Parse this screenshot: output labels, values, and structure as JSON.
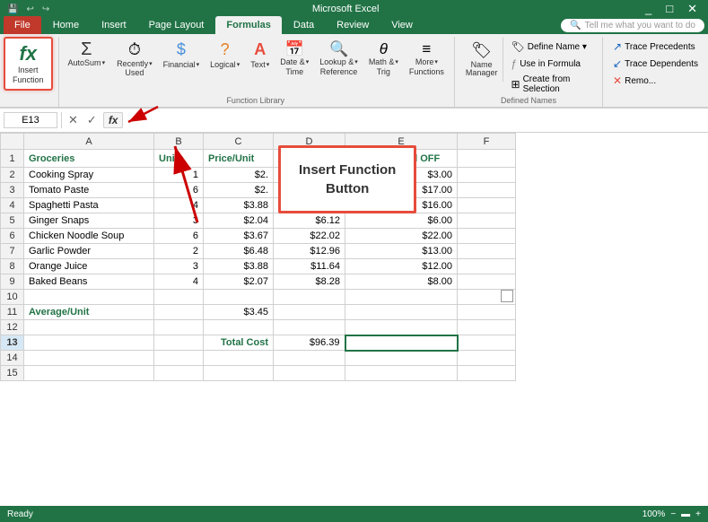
{
  "tabs": {
    "items": [
      "File",
      "Home",
      "Insert",
      "Page Layout",
      "Formulas",
      "Data",
      "Review",
      "View"
    ],
    "active": "Formulas"
  },
  "ribbon": {
    "group1": {
      "label": "",
      "buttons": [
        {
          "id": "insert-function",
          "icon": "fx",
          "label": "Insert\nFunction",
          "active": true
        }
      ]
    },
    "group2": {
      "label": "Function Library",
      "buttons": [
        {
          "id": "autosum",
          "icon": "Σ",
          "label": "AutoSum"
        },
        {
          "id": "recently-used",
          "icon": "⏱",
          "label": "Recently\nUsed"
        },
        {
          "id": "financial",
          "icon": "$",
          "label": "Financial"
        },
        {
          "id": "logical",
          "icon": "?",
          "label": "Logical"
        },
        {
          "id": "text",
          "icon": "A",
          "label": "Text"
        },
        {
          "id": "date-time",
          "icon": "📅",
          "label": "Date &\nTime"
        },
        {
          "id": "lookup-ref",
          "icon": "🔍",
          "label": "Lookup &\nReference"
        },
        {
          "id": "math-trig",
          "icon": "θ",
          "label": "Math &\nTrig"
        },
        {
          "id": "more-functions",
          "icon": "≡",
          "label": "More\nFunctions"
        }
      ]
    },
    "group3": {
      "label": "Defined Names",
      "buttons": [
        {
          "id": "name-manager",
          "label": "Name\nManager"
        }
      ],
      "right_items": [
        "Define Name ▾",
        "Use in Formula",
        "Create from Selection"
      ]
    },
    "group4": {
      "label": "",
      "buttons": [
        "Trace Precedents",
        "Trace Dependents",
        "Remo..."
      ]
    }
  },
  "formulaBar": {
    "cellRef": "E13",
    "fxLabel": "fx"
  },
  "spreadsheet": {
    "columns": [
      "",
      "A",
      "B",
      "C",
      "D",
      "E",
      "F"
    ],
    "activeCell": "E13",
    "rows": [
      {
        "num": 1,
        "A": "Groceries",
        "B": "Units",
        "C": "Price/Unit",
        "D": "",
        "E": "Cost Rounded OFF",
        "F": "",
        "aStyle": "green",
        "eStyle": "green"
      },
      {
        "num": 2,
        "A": "Cooking Spray",
        "B": "1",
        "C": "$2.",
        "D": "",
        "E": "$3.00",
        "F": "",
        "cStyle": "right",
        "eStyle": "right"
      },
      {
        "num": 3,
        "A": "Tomato Paste",
        "B": "6",
        "C": "$2.",
        "D": "",
        "E": "$17.00",
        "F": "",
        "cStyle": "right",
        "eStyle": "right"
      },
      {
        "num": 4,
        "A": "Spaghetti Pasta",
        "B": "4",
        "C": "$3.88",
        "D": "$15.52",
        "E": "$16.00",
        "F": "",
        "cStyle": "right",
        "dStyle": "right",
        "eStyle": "right"
      },
      {
        "num": 5,
        "A": "Ginger Snaps",
        "B": "3",
        "C": "$2.04",
        "D": "$6.12",
        "E": "$6.00",
        "F": "",
        "cStyle": "right",
        "dStyle": "right",
        "eStyle": "right"
      },
      {
        "num": 6,
        "A": "Chicken Noodle Soup",
        "B": "6",
        "C": "$3.67",
        "D": "$22.02",
        "E": "$22.00",
        "F": "",
        "cStyle": "right",
        "dStyle": "right",
        "eStyle": "right"
      },
      {
        "num": 7,
        "A": "Garlic Powder",
        "B": "2",
        "C": "$6.48",
        "D": "$12.96",
        "E": "$13.00",
        "F": "",
        "cStyle": "right",
        "dStyle": "right",
        "eStyle": "right"
      },
      {
        "num": 8,
        "A": "Orange Juice",
        "B": "3",
        "C": "$3.88",
        "D": "$11.64",
        "E": "$12.00",
        "F": "",
        "cStyle": "right",
        "dStyle": "right",
        "eStyle": "right"
      },
      {
        "num": 9,
        "A": "Baked Beans",
        "B": "4",
        "C": "$2.07",
        "D": "$8.28",
        "E": "$8.00",
        "F": "",
        "cStyle": "right",
        "dStyle": "right",
        "eStyle": "right"
      },
      {
        "num": 10,
        "A": "",
        "B": "",
        "C": "",
        "D": "",
        "E": "",
        "F": ""
      },
      {
        "num": 11,
        "A": "Average/Unit",
        "B": "",
        "C": "$3.45",
        "D": "",
        "E": "",
        "F": "",
        "aStyle": "green",
        "cStyle": "right"
      },
      {
        "num": 12,
        "A": "",
        "B": "",
        "C": "",
        "D": "",
        "E": "",
        "F": ""
      },
      {
        "num": 13,
        "A": "",
        "B": "",
        "C": "Total Cost",
        "D": "$96.39",
        "E": "",
        "F": "",
        "cStyle": "green right",
        "dStyle": "right"
      },
      {
        "num": 14,
        "A": "",
        "B": "",
        "C": "",
        "D": "",
        "E": "",
        "F": ""
      },
      {
        "num": 15,
        "A": "",
        "B": "",
        "C": "",
        "D": "",
        "E": "",
        "F": ""
      }
    ]
  },
  "annotation": {
    "popup": {
      "line1": "Insert Function",
      "line2": "Button"
    }
  },
  "searchBar": {
    "placeholder": "Tell me what you want to do"
  },
  "colors": {
    "excel_green": "#217346",
    "ribbon_bg": "#f0f0f0",
    "active_border": "#e74c3c",
    "cell_green": "#217346"
  }
}
